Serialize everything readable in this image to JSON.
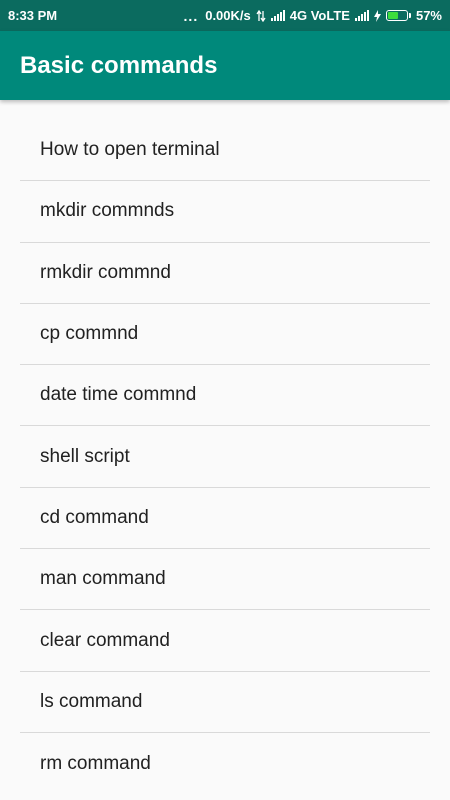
{
  "status_bar": {
    "time": "8:33 PM",
    "dots": "...",
    "speed": "0.00K/s",
    "network": "4G VoLTE",
    "battery_percent": "57%",
    "battery_level": 0.57
  },
  "app_bar": {
    "title": "Basic commands"
  },
  "list": {
    "items": [
      {
        "label": "How to open terminal"
      },
      {
        "label": "mkdir commnds"
      },
      {
        "label": "rmkdir commnd"
      },
      {
        "label": "cp commnd"
      },
      {
        "label": "date time commnd"
      },
      {
        "label": "shell script"
      },
      {
        "label": "cd command"
      },
      {
        "label": "man command"
      },
      {
        "label": "clear command"
      },
      {
        "label": "ls command"
      },
      {
        "label": "rm command"
      }
    ]
  },
  "colors": {
    "status_bar_bg": "#0b6b5f",
    "app_bar_bg": "#00897b",
    "list_bg": "#fafafa",
    "divider": "#d9d9d9",
    "battery_fill": "#3ddc3d"
  }
}
